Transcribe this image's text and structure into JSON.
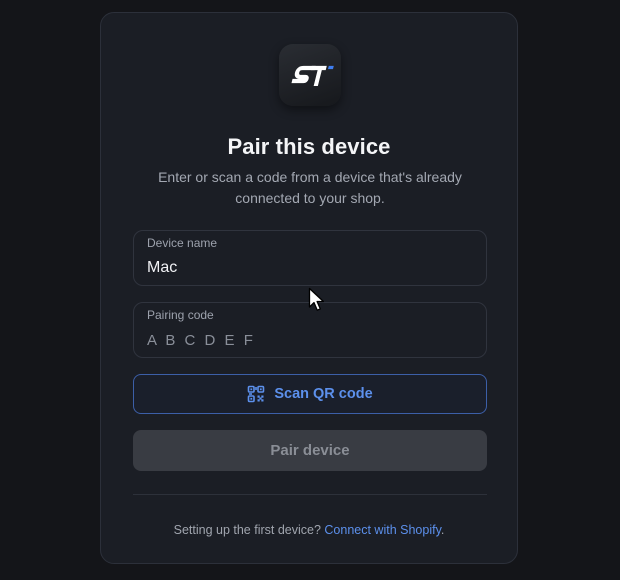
{
  "dialog": {
    "title": "Pair this device",
    "subtitle": "Enter or scan a code from a device that's already connected to your shop.",
    "logo": {
      "text": "ST",
      "icon": "app-logo-icon"
    }
  },
  "device_name": {
    "label": "Device name",
    "value": "Mac"
  },
  "pairing_code": {
    "label": "Pairing code",
    "placeholder": "A B C D E F",
    "value": ""
  },
  "scan_button": {
    "label": "Scan QR code",
    "icon": "qr-scan-icon"
  },
  "pair_button": {
    "label": "Pair device",
    "state": "disabled"
  },
  "footer": {
    "text": "Setting up the first device?",
    "link": "Connect with Shopify",
    "suffix": "."
  },
  "colors": {
    "background": "#141519",
    "card": "#1b1e25",
    "accent": "#5c90ec",
    "disabled_button": "#393c43"
  }
}
